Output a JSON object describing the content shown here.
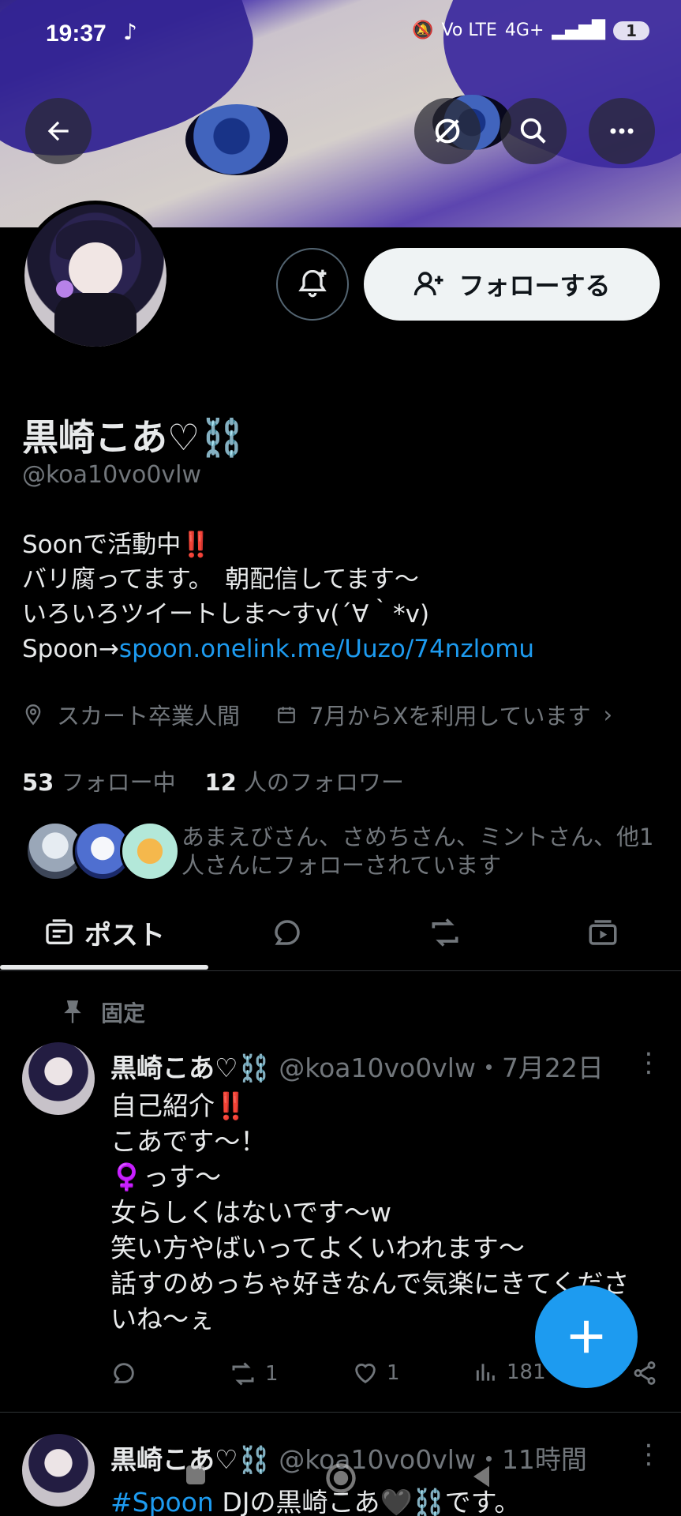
{
  "status_bar": {
    "time": "19:37",
    "tiktok_icon": "tiktok-icon",
    "network": "4G+",
    "volte": "Vo LTE",
    "battery": "1"
  },
  "header": {
    "back_icon": "back-arrow-icon",
    "grok_icon": "grok-icon",
    "search_icon": "search-icon",
    "more_icon": "more-icon"
  },
  "profile": {
    "name": "黒崎こあ♡⛓️",
    "handle": "@koa10vo0vlw",
    "follow_label": "フォローする",
    "bio": {
      "line1": "Soonで活動中",
      "line1_emoji": "‼️",
      "line2": "バリ腐ってます。　朝配信してます〜",
      "line3": "いろいろツイートしま〜すv(´∀｀*v)",
      "line4_prefix": "Spoon→",
      "line4_link": "spoon.onelink.me/Uuzo/74nzlomu"
    },
    "location": "スカート卒業人間",
    "joined": "7月からXを利用しています",
    "following_count": "53",
    "following_label": "フォロー中",
    "followers_count": "12",
    "followers_label": "人のフォロワー",
    "mutuals_text": "あまえびさん、さめちさん、ミントさん、他1人さんにフォローされています"
  },
  "tabs": [
    {
      "label": "ポスト",
      "icon": "posts-icon"
    },
    {
      "label": "",
      "icon": "replies-icon"
    },
    {
      "label": "",
      "icon": "retweet-icon"
    },
    {
      "label": "",
      "icon": "media-icon"
    }
  ],
  "pinned_label": "固定",
  "posts": [
    {
      "name": "黒崎こあ♡⛓️",
      "handle": "@koa10vo0vlw",
      "sep": "・",
      "date": "7月22日",
      "lines": [
        "自己紹介‼️",
        "こあです〜！",
        "♀️っす〜",
        "女らしくはないです〜w",
        "笑い方やばいってよくいわれます〜",
        "話すのめっちゃ好きなんで気楽にきてくださ",
        "いね〜ぇ"
      ],
      "retweets": "1",
      "likes": "1",
      "views": "181"
    },
    {
      "name": "黒崎こあ♡⛓️",
      "handle": "@koa10vo0vlw",
      "sep": "・",
      "date": "11時間",
      "hashtag": "#Spoon",
      "text": " DJの黒崎こあ🖤⛓️です。"
    }
  ],
  "colors": {
    "background": "#000000",
    "text_primary": "#e7e9ea",
    "text_secondary": "#71767b",
    "link": "#1d9bf0",
    "fab": "#1d9bf0"
  }
}
